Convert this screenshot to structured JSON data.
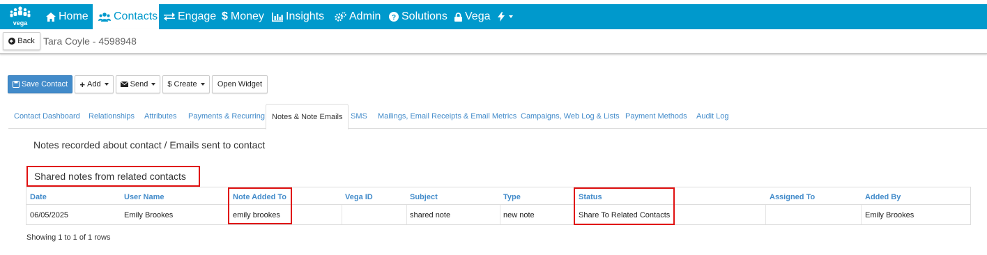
{
  "brand": {
    "logo_text": "vega"
  },
  "nav": {
    "home": "Home",
    "contacts": "Contacts",
    "engage": "Engage",
    "money": "Money",
    "insights": "Insights",
    "admin": "Admin",
    "solutions": "Solutions",
    "vega": "Vega"
  },
  "subheader": {
    "back_label": "Back",
    "contact_title": "Tara Coyle - 4598948"
  },
  "toolbar": {
    "save": "Save Contact",
    "add": "Add",
    "send": "Send",
    "create": "Create",
    "open_widget": "Open Widget"
  },
  "tabs": [
    "Contact Dashboard",
    "Relationships",
    "Attributes",
    "Payments & Recurring",
    "Notes & Note Emails",
    "SMS",
    "Mailings, Email Receipts & Email Metrics",
    "Campaigns, Web Log & Lists",
    "Payment Methods",
    "Audit Log"
  ],
  "active_tab": "Notes & Note Emails",
  "section_heading": "Notes recorded about contact / Emails sent to contact",
  "shared_heading": "Shared notes from related contacts",
  "table": {
    "columns": [
      "Date",
      "User Name",
      "Note Added To",
      "Vega ID",
      "Subject",
      "Type",
      "Status",
      "Assigned To",
      "Added By"
    ],
    "rows": [
      [
        "06/05/2025",
        "Emily Brookes",
        "emily brookes",
        "",
        "shared note",
        "new note",
        "Share To Related Contacts",
        "",
        "Emily Brookes"
      ]
    ]
  },
  "footer": {
    "showing": "Showing 1 to 1 of 1 rows"
  },
  "colors": {
    "nav_bg": "#0099cc",
    "primary": "#428bca",
    "highlight": "#e01010"
  }
}
